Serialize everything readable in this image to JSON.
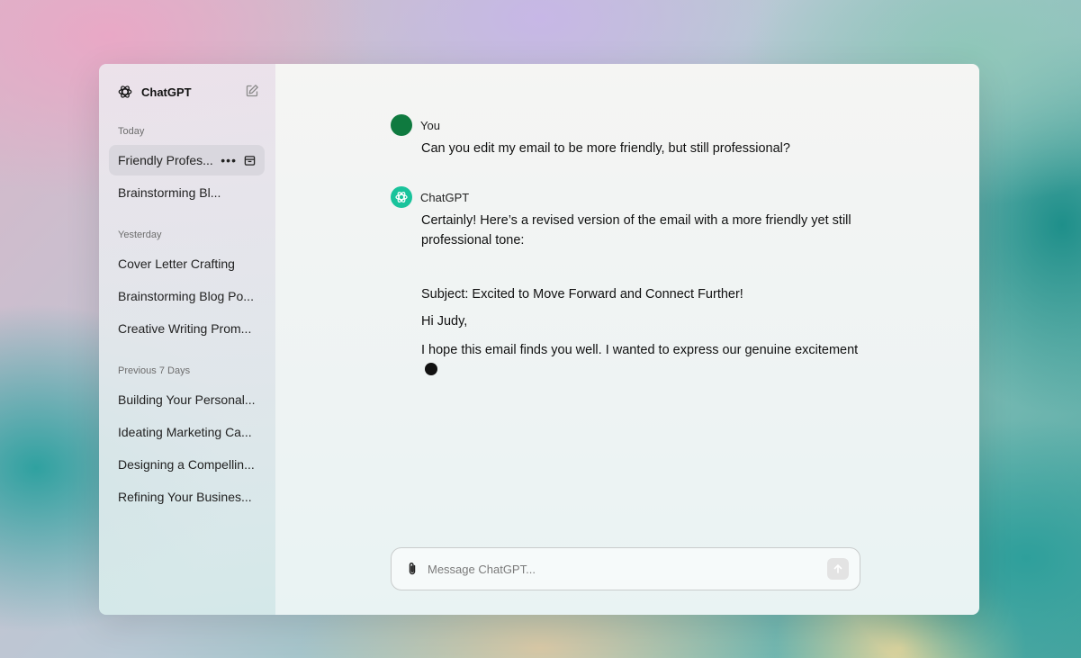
{
  "app": {
    "title": "ChatGPT"
  },
  "sidebar": {
    "sections": [
      {
        "label": "Today",
        "items": [
          {
            "label": "Friendly Profes...",
            "active": true
          },
          {
            "label": "Brainstorming Bl..."
          }
        ]
      },
      {
        "label": "Yesterday",
        "items": [
          {
            "label": "Cover Letter Crafting"
          },
          {
            "label": "Brainstorming Blog Po..."
          },
          {
            "label": "Creative Writing Prom..."
          }
        ]
      },
      {
        "label": "Previous 7 Days",
        "items": [
          {
            "label": "Building Your Personal..."
          },
          {
            "label": "Ideating Marketing Ca..."
          },
          {
            "label": "Designing a Compellin..."
          },
          {
            "label": "Refining Your Busines..."
          }
        ]
      }
    ],
    "item_menu_label": "•••"
  },
  "conversation": {
    "user": {
      "name": "You",
      "text": "Can you edit my email to be more friendly, but still professional?"
    },
    "assistant": {
      "name": "ChatGPT",
      "intro": "Certainly! Here’s a revised version of the email with a more friendly yet still professional tone:",
      "subject": "Subject: Excited to Move Forward and Connect Further!",
      "greeting": "Hi Judy,",
      "body": "I hope this email finds you well. I wanted to express our genuine excitement"
    }
  },
  "composer": {
    "placeholder": "Message ChatGPT..."
  },
  "icons": {
    "logo": "openai-logo-icon",
    "edit": "new-chat-icon",
    "archive": "archive-icon",
    "attach": "paperclip-icon",
    "send": "arrow-up-icon"
  },
  "colors": {
    "user_avatar": "#0f7a3f",
    "assistant_avatar": "#19c39b"
  }
}
